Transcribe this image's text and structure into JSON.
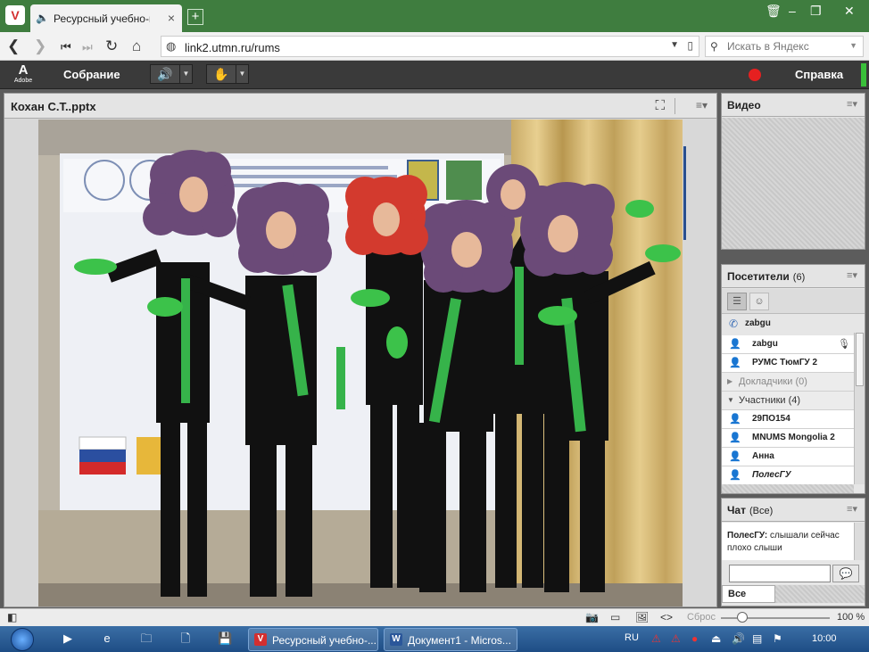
{
  "browser": {
    "tab": {
      "title": "Ресурсный учебно-методи"
    },
    "address": {
      "url": "link2.utmn.ru/rums"
    },
    "search": {
      "placeholder": "Искать в Яндекс"
    }
  },
  "connect": {
    "logo_text": "Adobe",
    "menu_meeting": "Собрание",
    "menu_help": "Справка",
    "share_pod": {
      "title": "Кохан С.Т..pptx"
    },
    "video_pod": {
      "title": "Видео"
    },
    "attendees_pod": {
      "title": "Посетители",
      "count": "(6)",
      "phone_user": "zabgu",
      "hosts": [
        "zabgu",
        "РУМС ТюмГУ 2"
      ],
      "presenters_label": "Докладчики (0)",
      "participants_label": "Участники (4)",
      "participants": [
        "29ПО154",
        "MNUMS Mongolia 2",
        "Анна",
        "ПолесГУ"
      ]
    },
    "chat_pod": {
      "title": "Чат",
      "scope": "(Все)",
      "message_author": "ПолесГУ:",
      "message_text": "слышали сейчас плохо слыши",
      "target": "Все"
    },
    "statusbar": {
      "reset_label": "Сброс",
      "zoom": "100 %"
    }
  },
  "taskbar": {
    "tasks": [
      "Ресурсный учебно-...",
      "Документ1 - Micros..."
    ],
    "lang": "RU",
    "time": "10:00"
  },
  "colors": {
    "browser_accent": "#3f7d3f",
    "connect_bar": "#3a3a3a",
    "rec": "#e62020"
  }
}
